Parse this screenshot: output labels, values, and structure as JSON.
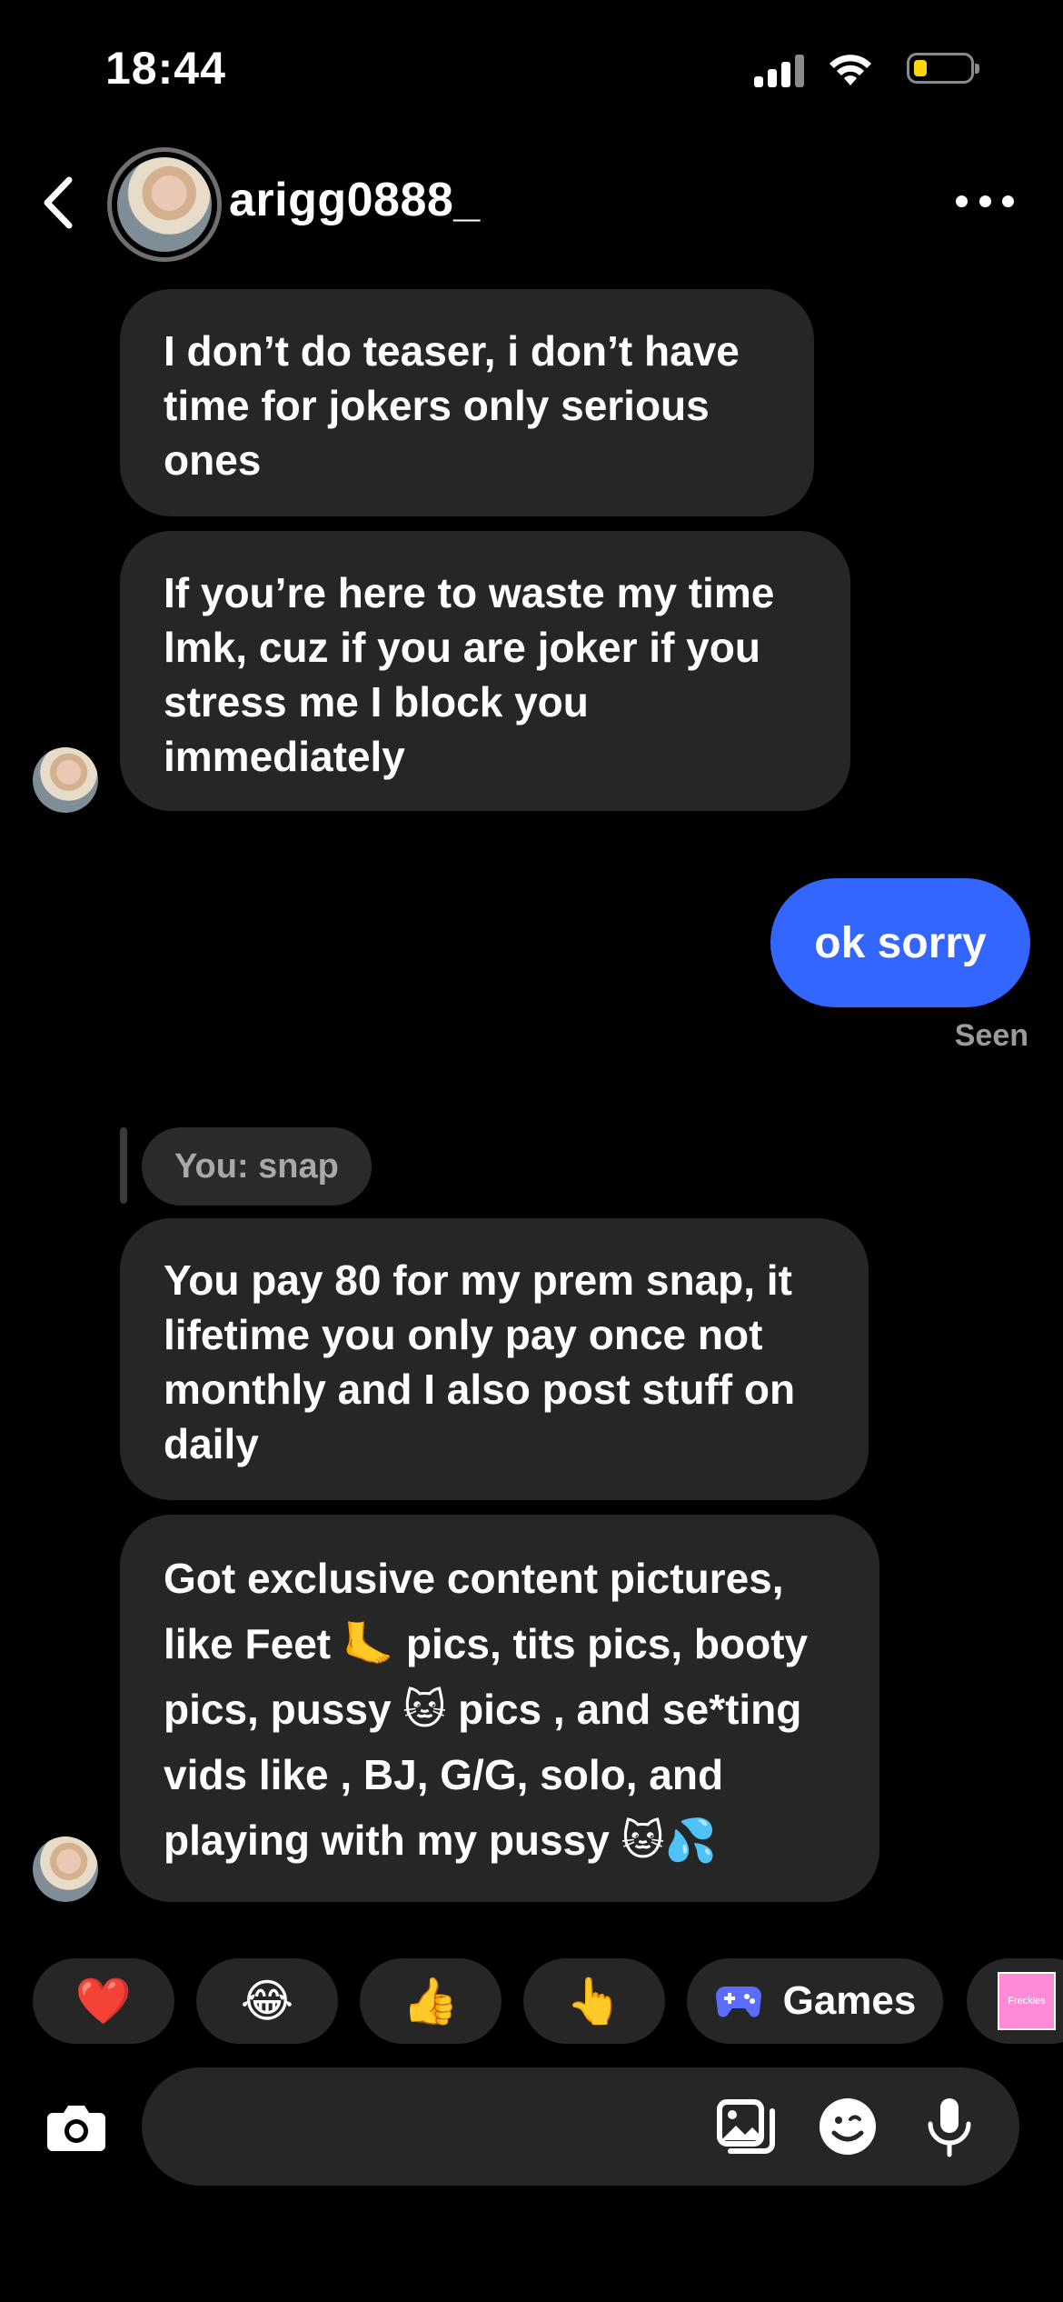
{
  "status_bar": {
    "time": "18:44"
  },
  "header": {
    "username": "arigg0888_"
  },
  "messages": [
    {
      "direction": "incoming",
      "text": "I don’t do teaser, i don’t have time for jokers only serious ones"
    },
    {
      "direction": "incoming",
      "text": "If you’re here to waste my time lmk, cuz if you are joker if you stress me I block you immediately"
    },
    {
      "direction": "outgoing",
      "text": "ok sorry"
    },
    {
      "direction": "incoming",
      "text": "You pay 80 for my prem snap, it lifetime you only pay once not monthly and I also post stuff on daily"
    },
    {
      "direction": "incoming",
      "text": "Got exclusive content pictures, like Feet 🦶 pics, tits pics, booty pics, pussy 🐱 pics , and se*ting vids like , BJ, G/G, solo, and playing with my pussy 🐱💦"
    }
  ],
  "seen_label": "Seen",
  "reply_preview": "You: snap",
  "quick_reactions": [
    "❤️",
    "😂",
    "👍",
    "👆"
  ],
  "games_label": "Games",
  "sticker_label": "Freckles",
  "composer": {
    "placeholder": ""
  },
  "colors": {
    "background": "#000000",
    "incoming_bubble": "#262626",
    "outgoing_bubble": "#3366ff",
    "seen_text": "#9a9a9a",
    "battery_level": "#ffd60a"
  },
  "icons": [
    "back-chevron-icon",
    "more-dots-icon",
    "camera-icon",
    "gallery-icon",
    "sticker-icon",
    "microphone-icon",
    "gamepad-icon",
    "wifi-icon",
    "signal-icon",
    "battery-icon"
  ]
}
